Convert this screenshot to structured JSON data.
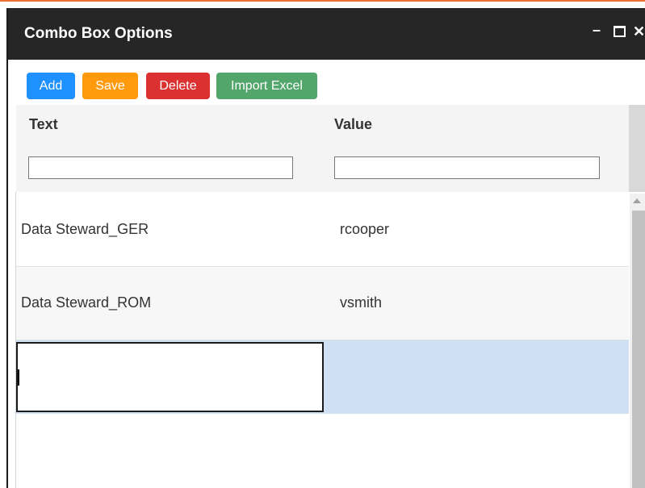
{
  "window": {
    "title": "Combo Box Options",
    "minimize_glyph": "–",
    "close_glyph": "✕",
    "accent_color": "#e8742e",
    "title_bar_color": "#262626"
  },
  "toolbar": {
    "buttons": [
      {
        "label": "Add",
        "color": "#1e90ff"
      },
      {
        "label": "Save",
        "color": "#ff9a0d"
      },
      {
        "label": "Delete",
        "color": "#dc3131"
      },
      {
        "label": "Import Excel",
        "color": "#52a56b"
      }
    ]
  },
  "grid": {
    "columns": [
      {
        "header": "Text",
        "filter_value": "",
        "filter_placeholder": ""
      },
      {
        "header": "Value",
        "filter_value": "",
        "filter_placeholder": ""
      }
    ],
    "rows": [
      {
        "text": "Data Steward_GER",
        "value": "rcooper"
      },
      {
        "text": "Data Steward_ROM",
        "value": "vsmith"
      },
      {
        "text": "",
        "value": "",
        "editing": true
      }
    ],
    "selected_row_color": "#cfe0f5"
  }
}
